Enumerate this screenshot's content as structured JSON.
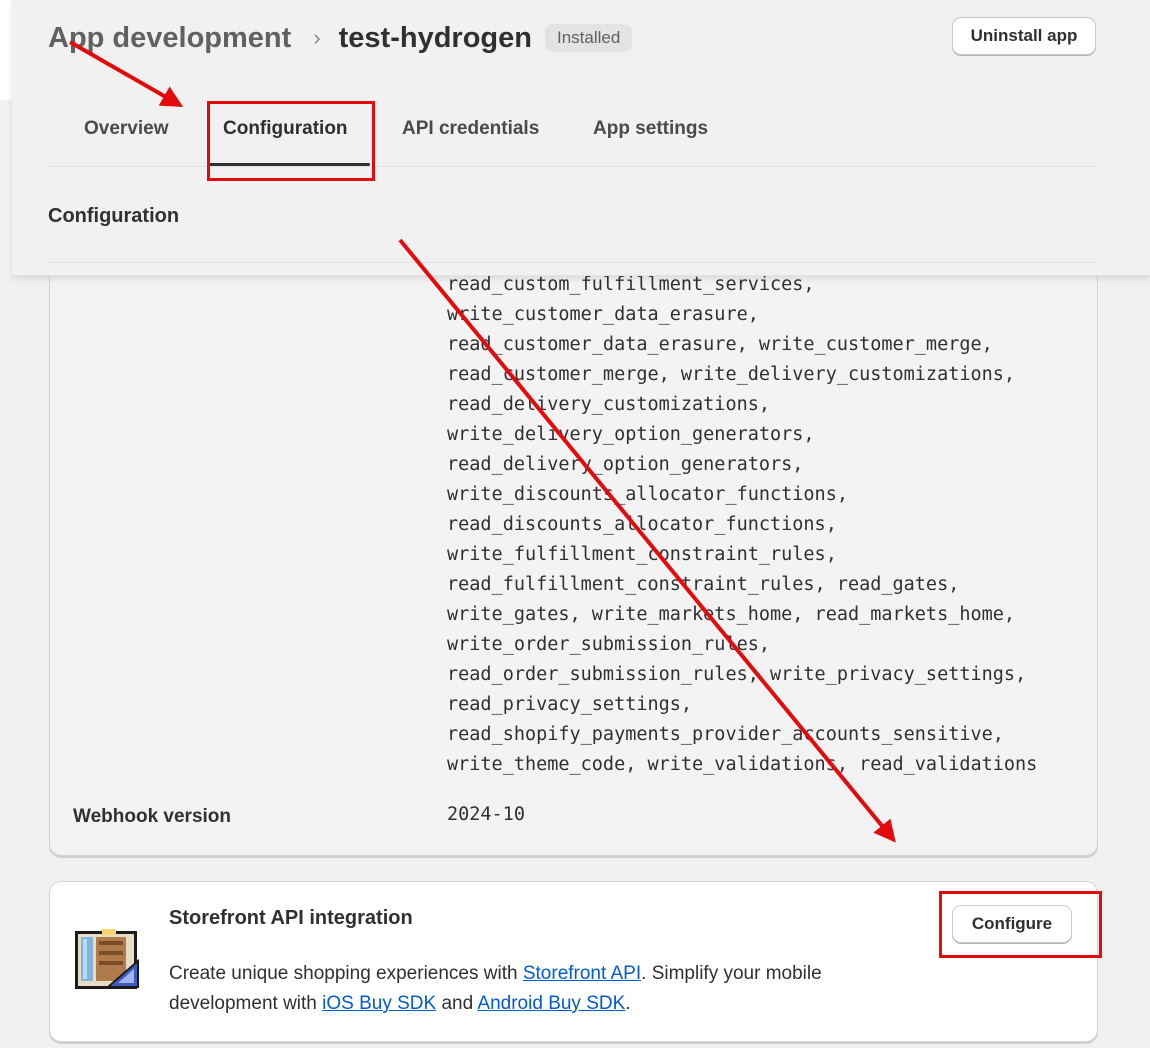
{
  "header": {
    "breadcrumb_parent": "App development",
    "breadcrumb_separator": "›",
    "app_name": "test-hydrogen",
    "status_badge": "Installed",
    "uninstall_label": "Uninstall app"
  },
  "tabs": [
    {
      "label": "Overview",
      "active": false
    },
    {
      "label": "Configuration",
      "active": true
    },
    {
      "label": "API credentials",
      "active": false
    },
    {
      "label": "App settings",
      "active": false
    }
  ],
  "section_title": "Configuration",
  "scopes_lines": [
    "read_custom_fulfillment_services,",
    "write_customer_data_erasure,",
    "read_customer_data_erasure, write_customer_merge,",
    "read_customer_merge, write_delivery_customizations,",
    "read_delivery_customizations,",
    "write_delivery_option_generators,",
    "read_delivery_option_generators,",
    "write_discounts_allocator_functions,",
    "read_discounts_allocator_functions,",
    "write_fulfillment_constraint_rules,",
    "read_fulfillment_constraint_rules, read_gates,",
    "write_gates, write_markets_home, read_markets_home,",
    "write_order_submission_rules,",
    "read_order_submission_rules, write_privacy_settings,",
    "read_privacy_settings,",
    "read_shopify_payments_provider_accounts_sensitive,",
    "write_theme_code, write_validations, read_validations"
  ],
  "webhook": {
    "label": "Webhook version",
    "value": "2024-10"
  },
  "storefront": {
    "title": "Storefront API integration",
    "desc_part1": "Create unique shopping experiences with ",
    "link_storefront": "Storefront API",
    "desc_part2": ". Simplify your mobile development with ",
    "link_ios": "iOS Buy SDK",
    "desc_part3": " and ",
    "link_android": "Android Buy SDK",
    "desc_part4": ".",
    "configure_label": "Configure"
  },
  "colors": {
    "annotation_red": "#e30b0b",
    "link_blue": "#005bd3",
    "page_bg": "#f1f1f1"
  }
}
